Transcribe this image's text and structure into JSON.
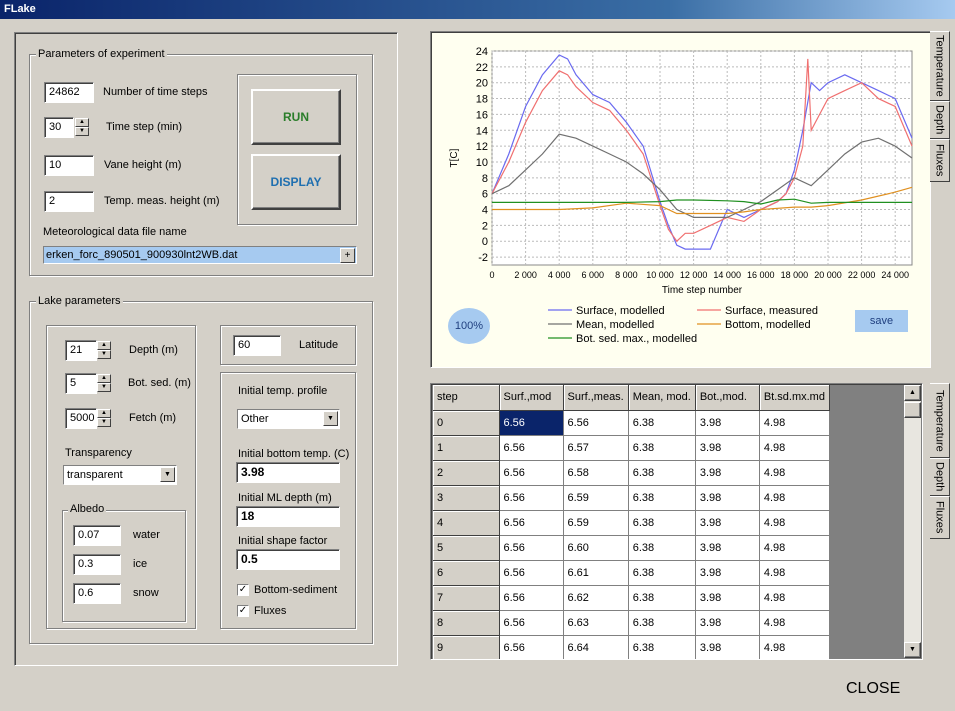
{
  "window": {
    "title": "FLake",
    "close_label": "CLOSE"
  },
  "experiment": {
    "title": "Parameters of experiment",
    "num_steps": {
      "value": "24862",
      "label": "Number of time steps"
    },
    "time_step": {
      "value": "30",
      "label": "Time step (min)"
    },
    "vane_height": {
      "value": "10",
      "label": "Vane height (m)"
    },
    "temp_height": {
      "value": "2",
      "label": "Temp. meas. height (m)"
    },
    "file_label": "Meteorological data file name",
    "file_value": "erken_forc_890501_900930lnt2WB.dat",
    "run_label": "RUN",
    "display_label": "DISPLAY"
  },
  "lake": {
    "title": "Lake parameters",
    "depth": {
      "value": "21",
      "label": "Depth (m)"
    },
    "bot_sed": {
      "value": "5",
      "label": "Bot. sed. (m)"
    },
    "fetch": {
      "value": "5000",
      "label": "Fetch (m)"
    },
    "transparency_label": "Transparency",
    "transparency_value": "transparent",
    "latitude": {
      "value": "60",
      "label": "Latitude"
    },
    "albedo": {
      "title": "Albedo",
      "water": {
        "value": "0.07",
        "label": "water"
      },
      "ice": {
        "value": "0.3",
        "label": "ice"
      },
      "snow": {
        "value": "0.6",
        "label": "snow"
      }
    },
    "init_profile_label": "Initial temp. profile",
    "init_profile_value": "Other",
    "init_bottom_label": "Initial bottom temp. (C)",
    "init_bottom_value": "3.98",
    "init_ml_label": "Initial ML depth (m)",
    "init_ml_value": "18",
    "init_shape_label": "Initial shape factor",
    "init_shape_value": "0.5",
    "bottom_sediment_label": "Bottom-sediment",
    "fluxes_label": "Fluxes"
  },
  "chart_panel": {
    "zoom_label": "100%",
    "save_label": "save",
    "tabs": [
      "Temperature",
      "Depth",
      "Fluxes"
    ]
  },
  "chart_data": {
    "type": "line",
    "xlabel": "Time step number",
    "ylabel": "T[C]",
    "xlim": [
      0,
      25000
    ],
    "ylim": [
      -3,
      24
    ],
    "xticks": [
      "0",
      "2 000",
      "4 000",
      "6 000",
      "8 000",
      "10 000",
      "12 000",
      "14 000",
      "16 000",
      "18 000",
      "20 000",
      "22 000",
      "24 000"
    ],
    "yticks": [
      "-2",
      "0",
      "2",
      "4",
      "6",
      "8",
      "10",
      "12",
      "14",
      "16",
      "18",
      "20",
      "22",
      "24"
    ],
    "legend": [
      "Surface, modelled",
      "Surface, measured",
      "Mean, modelled",
      "Bottom, modelled",
      "Bot. sed. max., modelled"
    ],
    "series": [
      {
        "name": "Surface, modelled",
        "color": "#6a6af0",
        "x": [
          0,
          1000,
          2000,
          3000,
          4000,
          4500,
          5000,
          6000,
          7000,
          8000,
          9000,
          10000,
          10500,
          11000,
          11500,
          12000,
          13000,
          14000,
          15000,
          16000,
          17000,
          17500,
          18000,
          18500,
          19000,
          19500,
          20000,
          21000,
          22000,
          23000,
          24000,
          25000
        ],
        "values": [
          6,
          11,
          17,
          21,
          23.5,
          23,
          21,
          18.5,
          17.5,
          15,
          12,
          5,
          2,
          -0.5,
          -1,
          -1,
          -1,
          4,
          3,
          4,
          5,
          6,
          9,
          14,
          20,
          19,
          20,
          21,
          20,
          19,
          18,
          13
        ]
      },
      {
        "name": "Surface, measured",
        "color": "#f07070",
        "x": [
          0,
          1000,
          2000,
          3000,
          4000,
          4500,
          5000,
          6000,
          7000,
          8000,
          9000,
          10000,
          10500,
          11000,
          11500,
          12000,
          13000,
          14000,
          15000,
          16000,
          17000,
          17500,
          18000,
          18500,
          18800,
          19000,
          19500,
          20000,
          21000,
          22000,
          23000,
          24000,
          25000
        ],
        "values": [
          6,
          10,
          15,
          19,
          21.5,
          21,
          19.5,
          17.5,
          16.5,
          14,
          11,
          4.5,
          1.5,
          0,
          1,
          1,
          2,
          3,
          2.5,
          4,
          5,
          6,
          8,
          12,
          23,
          14,
          16,
          18,
          19,
          20,
          18,
          17,
          12
        ]
      },
      {
        "name": "Mean, modelled",
        "color": "#707070",
        "x": [
          0,
          1000,
          2000,
          3000,
          4000,
          5000,
          6000,
          7000,
          8000,
          9000,
          10000,
          11000,
          12000,
          13000,
          14000,
          15000,
          16000,
          17000,
          18000,
          19000,
          20000,
          21000,
          22000,
          23000,
          24000,
          25000
        ],
        "values": [
          6,
          7,
          9,
          11,
          13.5,
          13,
          12,
          11,
          10,
          8.5,
          6.5,
          4,
          3,
          3,
          3,
          4,
          5,
          6.5,
          8,
          7,
          9,
          11,
          12.5,
          13,
          12,
          10.5
        ]
      },
      {
        "name": "Bottom, modelled",
        "color": "#e09020",
        "x": [
          0,
          2000,
          4000,
          6000,
          8000,
          10000,
          11000,
          12000,
          14000,
          15000,
          16000,
          18000,
          19000,
          20000,
          22000,
          24000,
          25000
        ],
        "values": [
          4,
          4,
          4,
          4.2,
          4.8,
          4.5,
          3.5,
          3.5,
          3.5,
          3.7,
          4,
          4.3,
          4.3,
          4.5,
          5.2,
          6.2,
          6.8
        ]
      },
      {
        "name": "Bot. sed. max., modelled",
        "color": "#209020",
        "x": [
          0,
          2000,
          4000,
          6000,
          8000,
          10000,
          11000,
          12000,
          14000,
          15000,
          16000,
          17000,
          18000,
          19000,
          20000,
          22000,
          24000,
          25000
        ],
        "values": [
          4.9,
          4.9,
          4.9,
          4.9,
          4.9,
          5,
          5.2,
          5.2,
          5.1,
          5,
          4.7,
          5.2,
          5.3,
          4.8,
          4.9,
          4.9,
          4.9,
          4.9
        ]
      }
    ]
  },
  "table": {
    "tabs": [
      "Temperature",
      "Depth",
      "Fluxes"
    ],
    "headers": [
      "step",
      "Surf.,mod",
      "Surf.,meas.",
      "Mean, mod.",
      "Bot.,mod.",
      "Bt.sd.mx.md"
    ],
    "rows": [
      [
        "0",
        "6.56",
        "6.56",
        "6.38",
        "3.98",
        "4.98"
      ],
      [
        "1",
        "6.56",
        "6.57",
        "6.38",
        "3.98",
        "4.98"
      ],
      [
        "2",
        "6.56",
        "6.58",
        "6.38",
        "3.98",
        "4.98"
      ],
      [
        "3",
        "6.56",
        "6.59",
        "6.38",
        "3.98",
        "4.98"
      ],
      [
        "4",
        "6.56",
        "6.59",
        "6.38",
        "3.98",
        "4.98"
      ],
      [
        "5",
        "6.56",
        "6.60",
        "6.38",
        "3.98",
        "4.98"
      ],
      [
        "6",
        "6.56",
        "6.61",
        "6.38",
        "3.98",
        "4.98"
      ],
      [
        "7",
        "6.56",
        "6.62",
        "6.38",
        "3.98",
        "4.98"
      ],
      [
        "8",
        "6.56",
        "6.63",
        "6.38",
        "3.98",
        "4.98"
      ],
      [
        "9",
        "6.56",
        "6.64",
        "6.38",
        "3.98",
        "4.98"
      ]
    ]
  }
}
